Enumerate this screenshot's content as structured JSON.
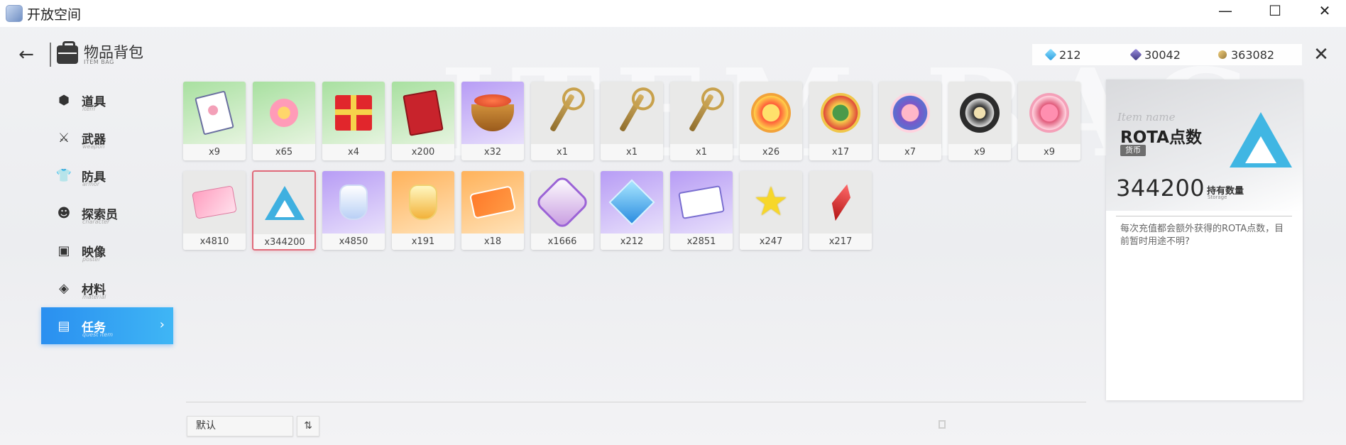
{
  "window": {
    "title": "开放空间",
    "controls": {
      "minimize": "—",
      "maximize": "☐",
      "close": "✕"
    }
  },
  "background_watermark": "ITEM BAG",
  "header": {
    "back_icon": "arrow-left-icon",
    "title": "物品背包",
    "subtitle": "ITEM BAG",
    "close_icon": "close-icon"
  },
  "currencies": [
    {
      "icon": "blue-gem-icon",
      "value": "212"
    },
    {
      "icon": "purple-gem-icon",
      "value": "30042"
    },
    {
      "icon": "gold-coin-icon",
      "value": "363082"
    }
  ],
  "sidebar": {
    "items": [
      {
        "label": "道具",
        "sub": "item",
        "icon": "item-icon",
        "glyph": "⬢",
        "active": false
      },
      {
        "label": "武器",
        "sub": "weapon",
        "icon": "weapon-icon",
        "glyph": "⚔",
        "active": false
      },
      {
        "label": "防具",
        "sub": "armor",
        "icon": "armor-icon",
        "glyph": "👕",
        "active": false
      },
      {
        "label": "探索员",
        "sub": "character",
        "icon": "character-icon",
        "glyph": "☻",
        "active": false
      },
      {
        "label": "映像",
        "sub": "poster",
        "icon": "poster-icon",
        "glyph": "▣",
        "active": false
      },
      {
        "label": "材料",
        "sub": "material",
        "icon": "material-icon",
        "glyph": "◈",
        "active": false
      },
      {
        "label": "任务",
        "sub": "quest item",
        "icon": "quest-icon",
        "glyph": "▤",
        "active": true
      }
    ],
    "active_chevron": "›"
  },
  "items": [
    {
      "count": "x9",
      "art": "notebook",
      "bg": "green"
    },
    {
      "count": "x65",
      "art": "flower",
      "bg": "green"
    },
    {
      "count": "x4",
      "art": "gift",
      "bg": "green"
    },
    {
      "count": "x200",
      "art": "book",
      "bg": "green"
    },
    {
      "count": "x32",
      "art": "pot",
      "bg": "purple"
    },
    {
      "count": "x1",
      "art": "key",
      "bg": "grey"
    },
    {
      "count": "x1",
      "art": "key",
      "bg": "grey"
    },
    {
      "count": "x1",
      "art": "key",
      "bg": "grey"
    },
    {
      "count": "x26",
      "art": "badge-yellow",
      "bg": "grey"
    },
    {
      "count": "x17",
      "art": "badge-red",
      "bg": "grey"
    },
    {
      "count": "x7",
      "art": "badge-torii",
      "bg": "grey"
    },
    {
      "count": "x9",
      "art": "badge-dark",
      "bg": "grey"
    },
    {
      "count": "x9",
      "art": "badge-torii2",
      "bg": "grey"
    },
    {
      "count": "x4810",
      "art": "game-card",
      "bg": "grey"
    },
    {
      "count": "x344200",
      "art": "rota-triangle",
      "bg": "grey",
      "selected": true
    },
    {
      "count": "x4850",
      "art": "bottle",
      "bg": "purple"
    },
    {
      "count": "x191",
      "art": "bottle-yellow",
      "bg": "orange"
    },
    {
      "count": "x18",
      "art": "ticket",
      "bg": "orange"
    },
    {
      "count": "x1666",
      "art": "hex-badge",
      "bg": "grey"
    },
    {
      "count": "x212",
      "art": "diamond",
      "bg": "purple"
    },
    {
      "count": "x2851",
      "art": "pass-card",
      "bg": "purple"
    },
    {
      "count": "x247",
      "art": "star",
      "bg": "grey"
    },
    {
      "count": "x217",
      "art": "crystal",
      "bg": "grey"
    }
  ],
  "detail": {
    "watermark": "Item name",
    "name": "ROTA点数",
    "tag": "货币",
    "quantity": "344200",
    "quantity_label": "持有数量",
    "quantity_sub": "Storage",
    "description": "每次充值都会额外获得的ROTA点数，目前暂时用途不明?"
  },
  "bottom": {
    "sort_value": "默认",
    "sort_toggle": "⇅"
  }
}
